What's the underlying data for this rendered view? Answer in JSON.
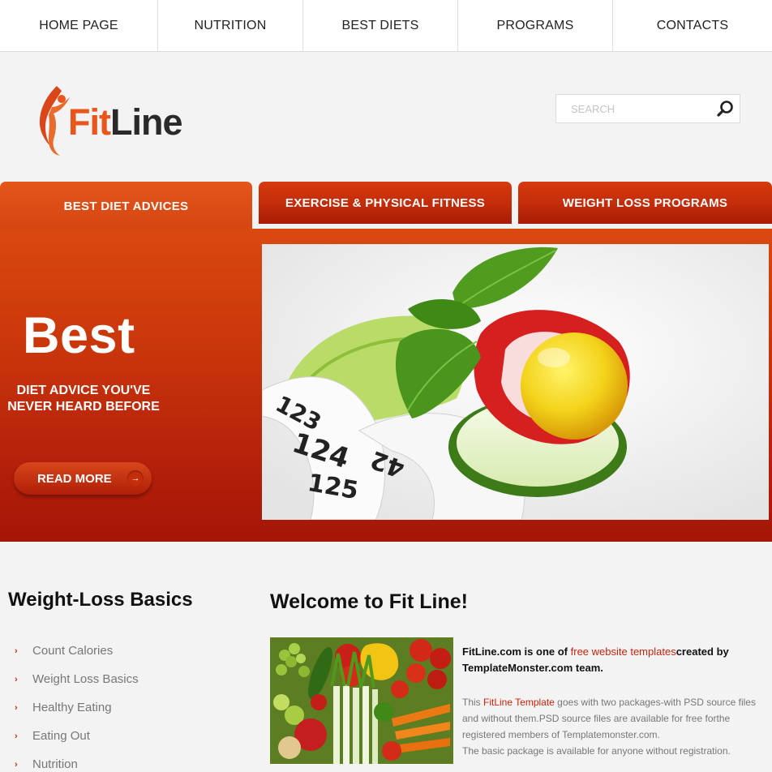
{
  "nav": {
    "items": [
      "HOME PAGE",
      "NUTRITION",
      "BEST DIETS",
      "PROGRAMS",
      "CONTACTS"
    ]
  },
  "header": {
    "logo_fit": "Fit",
    "logo_line": "Line",
    "search_placeholder": "SEARCH"
  },
  "tabs": [
    "BEST DIET ADVICES",
    "EXERCISE & PHYSICAL FITNESS",
    "WEIGHT LOSS PROGRAMS"
  ],
  "banner": {
    "headline": "Best",
    "subline_1": "DIET ADVICE YOU'VE",
    "subline_2": "NEVER HEARD BEFORE",
    "button": "READ MORE",
    "tape_numbers": [
      "123",
      "124",
      "125",
      "42"
    ]
  },
  "sidebar": {
    "title": "Weight-Loss Basics",
    "items": [
      "Count Calories",
      "Weight Loss Basics",
      "Healthy Eating",
      "Eating Out",
      "Nutrition"
    ]
  },
  "main": {
    "title": "Welcome to Fit Line!",
    "intro_1": "FitLine.com is one of ",
    "intro_link": "free website templates",
    "intro_2": "created by TemplateMonster.com team.",
    "body_1": "This ",
    "body_link": "FitLine Template",
    "body_2": " goes with two packages-with PSD source files and without them.PSD source files are available for free forthe registered members of Templatemonster.com.",
    "body_3": "The basic package is available for anyone without registration."
  },
  "colors": {
    "accent": "#e8561c",
    "banner_red": "#c22c0a",
    "link_red": "#c8230c"
  }
}
